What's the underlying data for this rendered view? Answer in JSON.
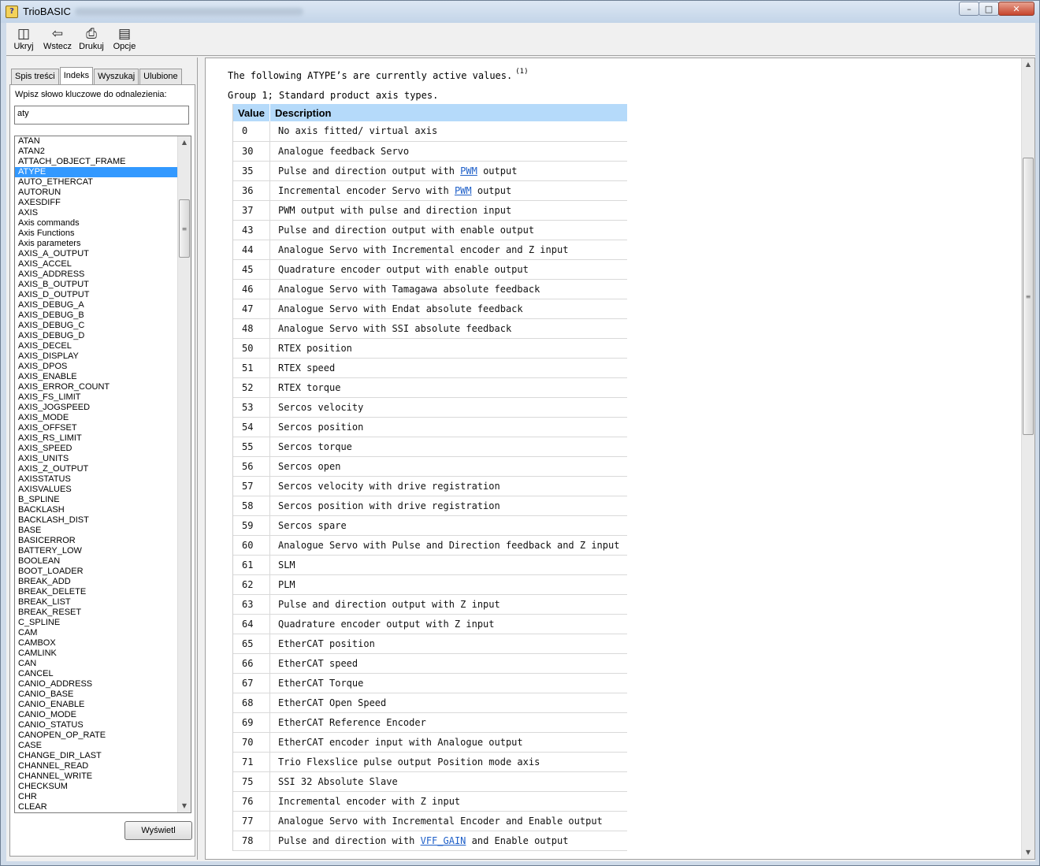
{
  "window": {
    "title": "TrioBASIC"
  },
  "toolbar": {
    "hide": "Ukryj",
    "back": "Wstecz",
    "print": "Drukuj",
    "options": "Opcje"
  },
  "tabs": {
    "contents": "Spis treści",
    "index": "Indeks",
    "search": "Wyszukaj",
    "favorites": "Ulubione"
  },
  "index": {
    "label": "Wpisz słowo kluczowe do odnalezienia:",
    "query": "aty",
    "selected": "ATYPE",
    "display_button": "Wyświetl",
    "items": [
      "ATAN",
      "ATAN2",
      "ATTACH_OBJECT_FRAME",
      "ATYPE",
      "AUTO_ETHERCAT",
      "AUTORUN",
      "AXESDIFF",
      "AXIS",
      "Axis commands",
      "Axis Functions",
      "Axis parameters",
      "AXIS_A_OUTPUT",
      "AXIS_ACCEL",
      "AXIS_ADDRESS",
      "AXIS_B_OUTPUT",
      "AXIS_D_OUTPUT",
      "AXIS_DEBUG_A",
      "AXIS_DEBUG_B",
      "AXIS_DEBUG_C",
      "AXIS_DEBUG_D",
      "AXIS_DECEL",
      "AXIS_DISPLAY",
      "AXIS_DPOS",
      "AXIS_ENABLE",
      "AXIS_ERROR_COUNT",
      "AXIS_FS_LIMIT",
      "AXIS_JOGSPEED",
      "AXIS_MODE",
      "AXIS_OFFSET",
      "AXIS_RS_LIMIT",
      "AXIS_SPEED",
      "AXIS_UNITS",
      "AXIS_Z_OUTPUT",
      "AXISSTATUS",
      "AXISVALUES",
      "B_SPLINE",
      "BACKLASH",
      "BACKLASH_DIST",
      "BASE",
      "BASICERROR",
      "BATTERY_LOW",
      "BOOLEAN",
      "BOOT_LOADER",
      "BREAK_ADD",
      "BREAK_DELETE",
      "BREAK_LIST",
      "BREAK_RESET",
      "C_SPLINE",
      "CAM",
      "CAMBOX",
      "CAMLINK",
      "CAN",
      "CANCEL",
      "CANIO_ADDRESS",
      "CANIO_BASE",
      "CANIO_ENABLE",
      "CANIO_MODE",
      "CANIO_STATUS",
      "CANOPEN_OP_RATE",
      "CASE",
      "CHANGE_DIR_LAST",
      "CHANNEL_READ",
      "CHANNEL_WRITE",
      "CHECKSUM",
      "CHR",
      "CLEAR"
    ]
  },
  "content": {
    "intro": "The following ATYPE’s are currently active values.",
    "footnote": "(1)",
    "group": "Group 1; Standard product axis types.",
    "table": {
      "headers": [
        "Value",
        "Description"
      ],
      "rows": [
        {
          "value": "0",
          "desc": "No axis fitted/ virtual axis"
        },
        {
          "value": "30",
          "desc": "Analogue feedback Servo"
        },
        {
          "value": "35",
          "pre": "Pulse and direction output with ",
          "link": "PWM",
          "post": " output"
        },
        {
          "value": "36",
          "pre": "Incremental encoder Servo with ",
          "link": "PWM",
          "post": " output"
        },
        {
          "value": "37",
          "desc": "PWM output with pulse and direction input"
        },
        {
          "value": "43",
          "desc": "Pulse and direction output with enable output"
        },
        {
          "value": "44",
          "desc": "Analogue Servo with Incremental encoder and Z input"
        },
        {
          "value": "45",
          "desc": "Quadrature encoder output with enable output"
        },
        {
          "value": "46",
          "desc": "Analogue Servo with Tamagawa absolute feedback"
        },
        {
          "value": "47",
          "desc": "Analogue Servo with Endat absolute feedback"
        },
        {
          "value": "48",
          "desc": "Analogue Servo with SSI absolute feedback"
        },
        {
          "value": "50",
          "desc": "RTEX position"
        },
        {
          "value": "51",
          "desc": "RTEX speed"
        },
        {
          "value": "52",
          "desc": "RTEX torque"
        },
        {
          "value": "53",
          "desc": "Sercos velocity"
        },
        {
          "value": "54",
          "desc": "Sercos position"
        },
        {
          "value": "55",
          "desc": "Sercos torque"
        },
        {
          "value": "56",
          "desc": "Sercos open"
        },
        {
          "value": "57",
          "desc": "Sercos velocity with drive registration"
        },
        {
          "value": "58",
          "desc": "Sercos position with drive registration"
        },
        {
          "value": "59",
          "desc": "Sercos spare"
        },
        {
          "value": "60",
          "desc": "Analogue Servo with Pulse and Direction feedback and Z input"
        },
        {
          "value": "61",
          "desc": "SLM"
        },
        {
          "value": "62",
          "desc": "PLM"
        },
        {
          "value": "63",
          "desc": "Pulse and direction output with Z input"
        },
        {
          "value": "64",
          "desc": "Quadrature encoder output with Z input"
        },
        {
          "value": "65",
          "desc": "EtherCAT position"
        },
        {
          "value": "66",
          "desc": "EtherCAT speed"
        },
        {
          "value": "67",
          "desc": "EtherCAT Torque"
        },
        {
          "value": "68",
          "desc": "EtherCAT Open Speed"
        },
        {
          "value": "69",
          "desc": "EtherCAT Reference Encoder"
        },
        {
          "value": "70",
          "desc": "EtherCAT encoder input with Analogue output"
        },
        {
          "value": "71",
          "desc": "Trio Flexslice pulse output Position mode axis"
        },
        {
          "value": "75",
          "desc": "SSI 32 Absolute Slave"
        },
        {
          "value": "76",
          "desc": "Incremental encoder with Z input"
        },
        {
          "value": "77",
          "desc": "Analogue Servo with Incremental Encoder and Enable output"
        },
        {
          "value": "78",
          "pre": "Pulse and direction with ",
          "link": "VFF_GAIN",
          "post": " and Enable output"
        }
      ]
    }
  },
  "icons": {
    "app": "help-icon",
    "hide": "hide-pane-icon",
    "back": "back-arrow-icon",
    "print": "printer-icon",
    "options": "options-icon"
  },
  "colors": {
    "header_bg": "#b5dafa",
    "selection": "#3399ff",
    "link": "#1e5fc8"
  }
}
